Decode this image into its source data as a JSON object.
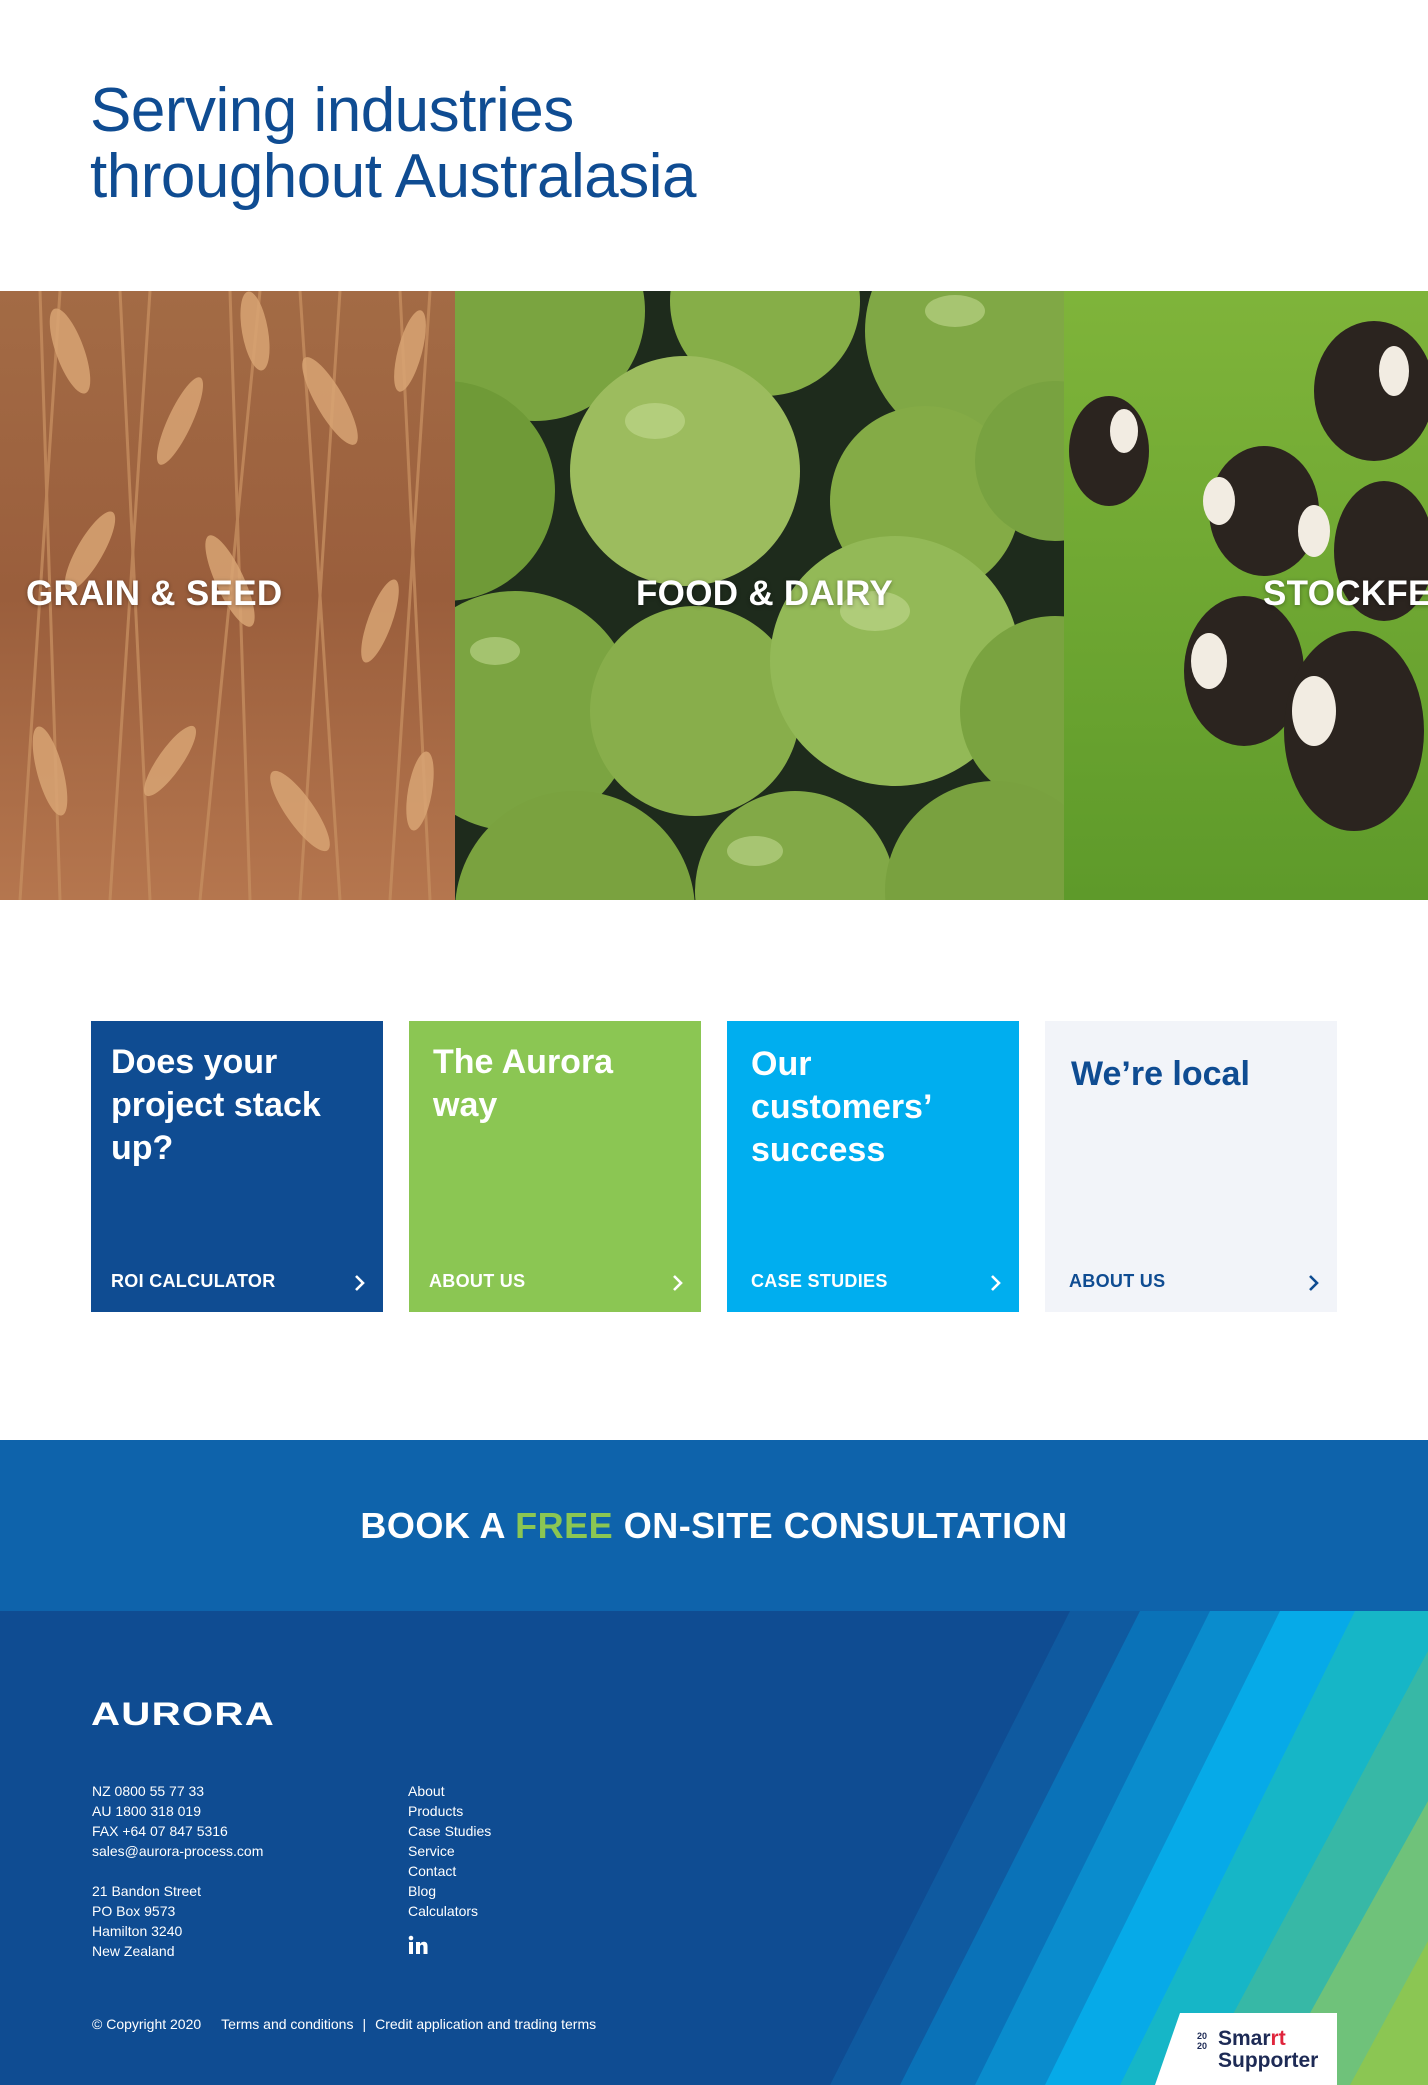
{
  "hero": {
    "title_line1": "Serving industries",
    "title_line2": "throughout Australasia"
  },
  "industries": [
    {
      "label": "GRAIN & SEED",
      "image": "wheat-field"
    },
    {
      "label": "FOOD & DAIRY",
      "image": "green-apples"
    },
    {
      "label": "STOCKFE",
      "image": "cows-in-pasture"
    }
  ],
  "cards": [
    {
      "title": "Does your project stack up?",
      "link": "ROI CALCULATOR",
      "bg": "#0f4c92"
    },
    {
      "title": "The Aurora way",
      "link": "ABOUT US",
      "bg": "#8bc653"
    },
    {
      "title": "Our customers’ success",
      "link": "CASE STUDIES",
      "bg": "#00aeef"
    },
    {
      "title": "We’re local",
      "link": "ABOUT US",
      "bg": "#f2f4f9"
    }
  ],
  "cta": {
    "before": "BOOK A ",
    "highlight": "FREE",
    "after": " ON-SITE CONSULTATION"
  },
  "footer": {
    "logo_text": "AURORA",
    "phone_nz": "NZ 0800 55 77 33",
    "phone_au": "AU 1800 318 019",
    "fax": "FAX +64 07 847 5316",
    "email": "sales@aurora-process.com",
    "address_line1": "21 Bandon Street",
    "address_line2": "PO Box 9573",
    "address_line3": "Hamilton 3240",
    "address_line4": "New Zealand",
    "links": [
      "About",
      "Products",
      "Case Studies",
      "Service",
      "Contact",
      "Blog",
      "Calculators"
    ],
    "social_icon": "linkedin-icon",
    "copyright": "© Copyright 2020",
    "terms": "Terms and conditions",
    "separator": "|",
    "credit": "Credit application and trading terms",
    "badge_year": "2020",
    "badge_line1a": "Smar",
    "badge_line1b": "rt",
    "badge_line2": "Supporter"
  },
  "colors": {
    "brand_blue": "#0f4c92",
    "cta_blue": "#0e63ab",
    "green": "#8bc653",
    "cyan": "#00aeef",
    "light": "#f2f4f9"
  }
}
